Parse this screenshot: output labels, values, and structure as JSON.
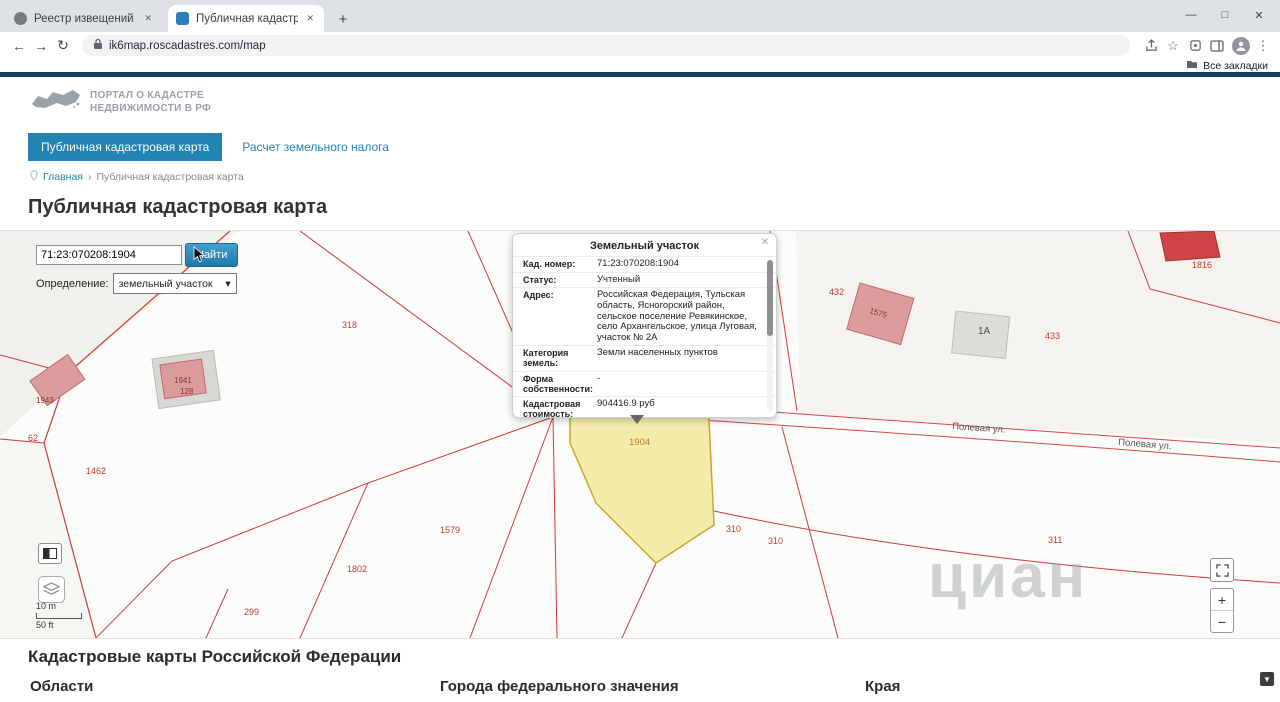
{
  "browser": {
    "tabs": [
      {
        "title": "Реестр извещений"
      },
      {
        "title": "Публичная кадастровая ка"
      }
    ],
    "url": "ik6map.roscadastres.com/map",
    "bookmarks_label": "Все закладки"
  },
  "icons": {
    "close": "✕",
    "minimize": "—",
    "maximize": "□",
    "back": "←",
    "forward": "→",
    "reload": "↻",
    "star": "☆",
    "menu": "⋮",
    "new_tab": "+",
    "plus": "+",
    "minus": "−",
    "dropdown": "▾",
    "breadcrumb_sep": "›",
    "scroll_down": "▼"
  },
  "site": {
    "logo_line1": "ПОРТАЛ О КАДАСТРЕ",
    "logo_line2": "НЕДВИЖИМОСТИ В РФ",
    "nav": [
      {
        "label": "Публичная кадастровая карта"
      },
      {
        "label": "Расчет земельного налога"
      }
    ],
    "breadcrumb": {
      "home": "Главная",
      "current": "Публичная кадастровая карта"
    },
    "page_title": "Публичная кадастровая карта"
  },
  "map": {
    "search_value": "71:23:070208:1904",
    "search_button": "Найти",
    "filter_label": "Определение:",
    "filter_value": "земельный участок",
    "scale_m": "10 m",
    "scale_ft": "50 ft",
    "watermark": "циан",
    "street_labels": [
      {
        "label": "Полевая ул."
      },
      {
        "label": "Полевая ул."
      }
    ],
    "parcels": [
      {
        "label": "62"
      },
      {
        "label": "1462"
      },
      {
        "label": "1943"
      },
      {
        "label": "1941"
      },
      {
        "label": "128"
      },
      {
        "label": "318"
      },
      {
        "label": "1579"
      },
      {
        "label": "1802"
      },
      {
        "label": "299"
      },
      {
        "label": "1904"
      },
      {
        "label": "310"
      },
      {
        "label": "310"
      },
      {
        "label": "311"
      },
      {
        "label": "433"
      },
      {
        "label": "432"
      },
      {
        "label": "1575"
      },
      {
        "label": "1А"
      },
      {
        "label": "1816"
      }
    ]
  },
  "popup": {
    "title": "Земельный участок",
    "rows": [
      {
        "label": "Кад. номер:",
        "value": "71:23:070208:1904"
      },
      {
        "label": "Статус:",
        "value": "Учтенный"
      },
      {
        "label": "Адрес:",
        "value": "Российская Федерация, Тульская область, Ясногорский район, сельское поселение Ревякинское, село Архангельское, улица Луговая, участок № 2А"
      },
      {
        "label": "Категория земель:",
        "value": "Земли населенных пунктов"
      },
      {
        "label": "Форма собственности:",
        "value": "-"
      },
      {
        "label": "Кадастровая стоимость:",
        "value": "904416.9 руб"
      }
    ]
  },
  "footer": {
    "heading": "Кадастровые карты Российской Федерации",
    "columns": [
      "Области",
      "Города федерального значения",
      "Края"
    ]
  }
}
